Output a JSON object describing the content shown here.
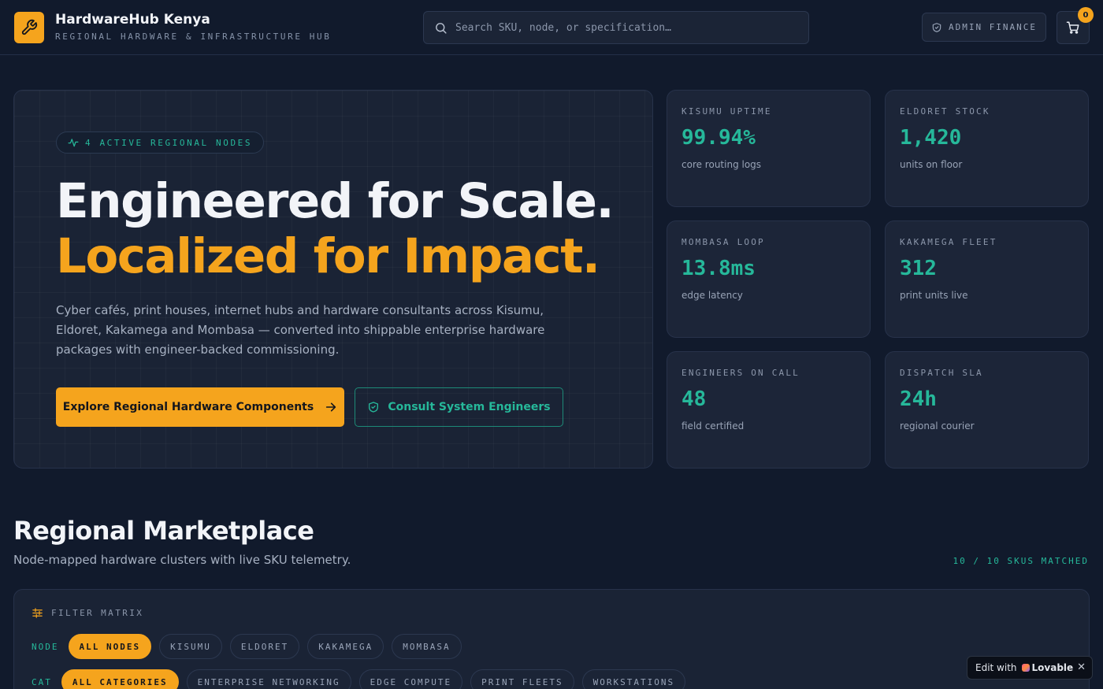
{
  "header": {
    "brand_name": "HardwareHub Kenya",
    "brand_tagline": "REGIONAL HARDWARE & INFRASTRUCTURE HUB",
    "search_placeholder": "Search SKU, node, or specification…",
    "admin_label": "ADMIN FINANCE",
    "cart_count": "0"
  },
  "hero": {
    "pill": "4 ACTIVE REGIONAL NODES",
    "title_line1": "Engineered for Scale.",
    "title_line2": "Localized for Impact.",
    "description": "Cyber cafés, print houses, internet hubs and hardware consultants across Kisumu, Eldoret, Kakamega and Mombasa — converted into shippable enterprise hardware packages with engineer-backed commissioning.",
    "primary_button": "Explore Regional Hardware Components",
    "secondary_button": "Consult System Engineers"
  },
  "stats": [
    {
      "label": "KISUMU UPTIME",
      "value": "99.94%",
      "sub": "core routing logs"
    },
    {
      "label": "ELDORET STOCK",
      "value": "1,420",
      "sub": "units on floor"
    },
    {
      "label": "MOMBASA LOOP",
      "value": "13.8ms",
      "sub": "edge latency"
    },
    {
      "label": "KAKAMEGA FLEET",
      "value": "312",
      "sub": "print units live"
    },
    {
      "label": "ENGINEERS ON CALL",
      "value": "48",
      "sub": "field certified"
    },
    {
      "label": "DISPATCH SLA",
      "value": "24h",
      "sub": "regional courier"
    }
  ],
  "marketplace": {
    "title": "Regional Marketplace",
    "subtitle": "Node-mapped hardware clusters with live SKU telemetry.",
    "match_count": "10 / 10 SKUS MATCHED",
    "filter_title": "FILTER MATRIX",
    "node_label": "NODE",
    "nodes": [
      "ALL NODES",
      "KISUMU",
      "ELDORET",
      "KAKAMEGA",
      "MOMBASA"
    ],
    "cat_label": "CAT",
    "categories": [
      "ALL CATEGORIES",
      "ENTERPRISE NETWORKING",
      "EDGE COMPUTE",
      "PRINT FLEETS",
      "WORKSTATIONS"
    ]
  },
  "lovable_badge": {
    "prefix": "Edit with",
    "brand": "Lovable",
    "close": "✕"
  },
  "colors": {
    "accent": "#f5a41d",
    "teal": "#26b89a",
    "background": "#111a2c"
  }
}
